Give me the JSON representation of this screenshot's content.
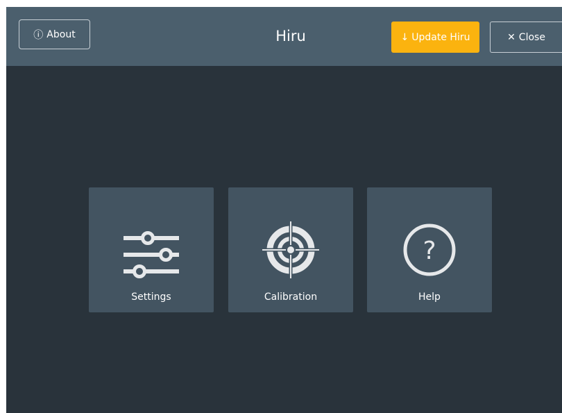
{
  "header": {
    "title": "Hiru",
    "about_label": "About",
    "update_label": "Update Hiru",
    "close_label": "Close",
    "about_icon": "info-circle-icon",
    "update_icon": "arrow-down-icon",
    "close_icon": "x-icon"
  },
  "tiles": [
    {
      "label": "Settings",
      "icon": "sliders-icon"
    },
    {
      "label": "Calibration",
      "icon": "crosshair-target-icon"
    },
    {
      "label": "Help",
      "icon": "question-circle-icon"
    }
  ],
  "colors": {
    "header_bg": "#4b5f6d",
    "body_bg": "#29333b",
    "tile_bg": "#435461",
    "accent": "#fbb30f",
    "icon": "#e6e8ea"
  }
}
